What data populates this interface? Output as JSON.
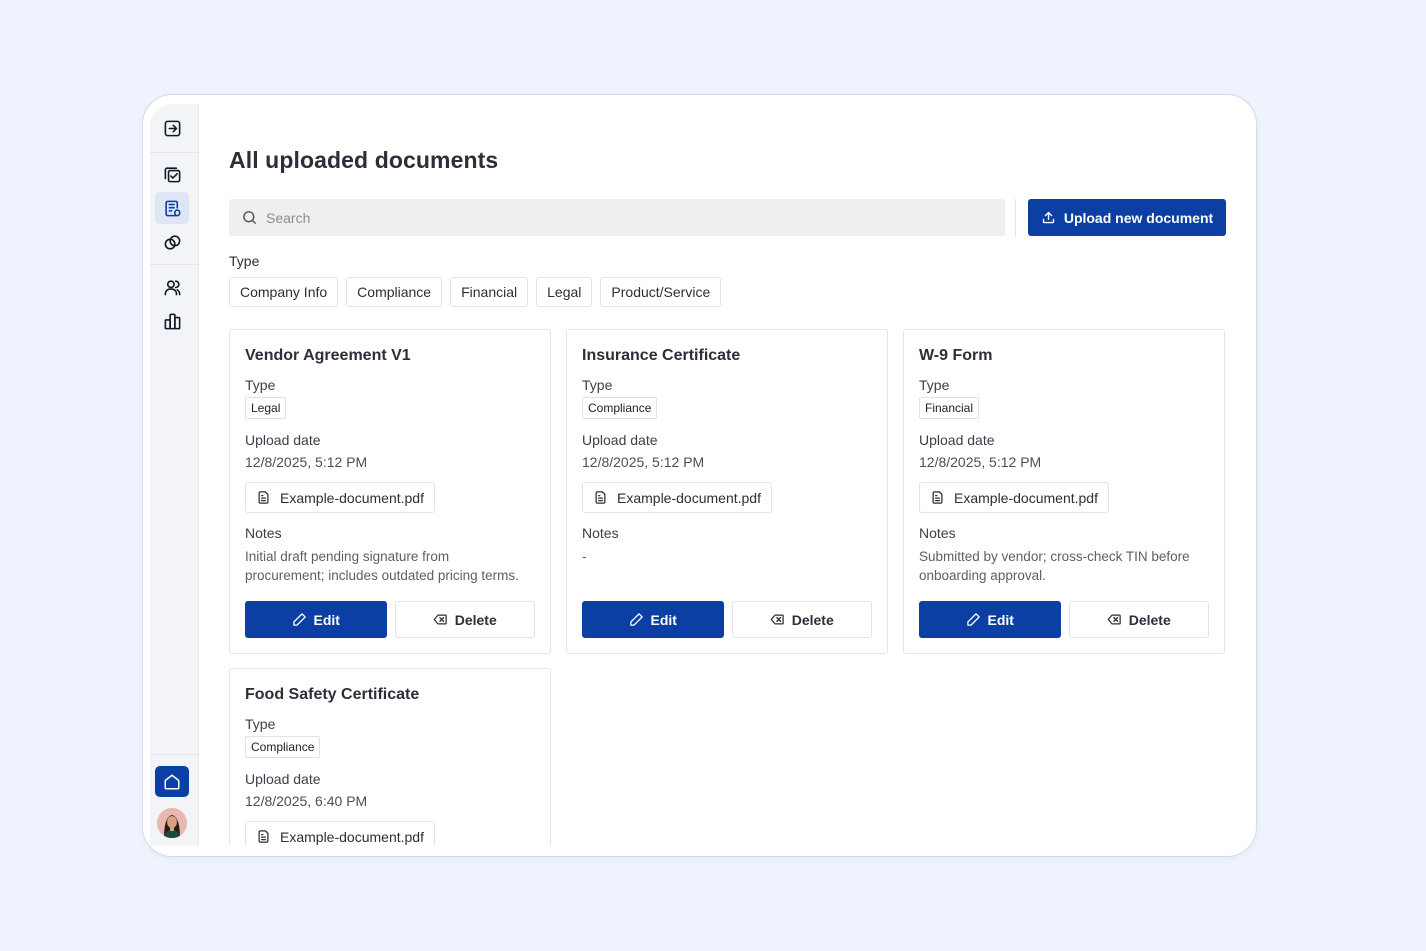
{
  "page": {
    "title": "All uploaded documents"
  },
  "search": {
    "placeholder": "Search"
  },
  "upload_button": {
    "label": "Upload new document"
  },
  "filters": {
    "label": "Type",
    "chips": [
      "Company Info",
      "Compliance",
      "Financial",
      "Legal",
      "Product/Service"
    ]
  },
  "sidebar": {
    "icons": [
      "collapse-sidebar-icon",
      "tasks-icon",
      "documents-icon",
      "integrations-icon",
      "contacts-icon",
      "analytics-icon"
    ],
    "active_item": "documents-icon",
    "bottom": [
      "home-icon",
      "avatar"
    ]
  },
  "field_labels": {
    "type": "Type",
    "upload_date": "Upload date",
    "notes": "Notes"
  },
  "actions": {
    "edit": "Edit",
    "delete": "Delete"
  },
  "documents": [
    {
      "title": "Vendor Agreement V1",
      "type": "Legal",
      "upload_date": "12/8/2025, 5:12 PM",
      "file": "Example-document.pdf",
      "notes_line1": "Initial draft pending signature from",
      "notes_line2": "procurement; includes outdated pricing terms."
    },
    {
      "title": "Insurance Certificate",
      "type": "Compliance",
      "upload_date": "12/8/2025, 5:12 PM",
      "file": "Example-document.pdf",
      "notes_line1": "-",
      "notes_line2": ""
    },
    {
      "title": "W-9 Form",
      "type": "Financial",
      "upload_date": "12/8/2025, 5:12 PM",
      "file": "Example-document.pdf",
      "notes_line1": "Submitted by vendor; cross-check TIN before",
      "notes_line2": "onboarding approval."
    },
    {
      "title": "Food Safety Certificate",
      "type": "Compliance",
      "upload_date": "12/8/2025, 6:40 PM",
      "file": "Example-document.pdf",
      "notes_line1": "",
      "notes_line2": ""
    }
  ],
  "colors": {
    "primary": "#0c3fa3",
    "background": "#eef3fe",
    "sidebar": "#f3f4f7"
  }
}
